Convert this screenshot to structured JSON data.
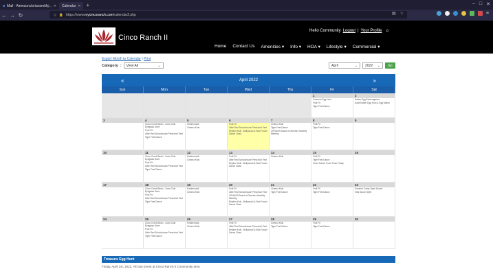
{
  "browser": {
    "tabs": [
      {
        "label": "Mail - Aiemsoncloriansmithj..."
      },
      {
        "label": "Calendar"
      }
    ],
    "url_prefix": "https://www.",
    "url_domain": "mycincoranch.com",
    "url_path": "/calendar2.php"
  },
  "site": {
    "name": "Cinco Ranch II",
    "greeting": "Hello Community",
    "logout": "Logout",
    "separator": "|",
    "profile": "Your Profile",
    "menu": [
      "Home",
      "Contact Us",
      "Amenities ▾",
      "Info ▾",
      "HOA ▾",
      "Lifestyle ▾",
      "Commercial ▾"
    ]
  },
  "links": {
    "export": "Export Month to Calendar",
    "sep": " | ",
    "print": "Print"
  },
  "filter": {
    "label": "Category",
    "value": "View All",
    "month": "April",
    "year": "2022",
    "go": "Go"
  },
  "calendar": {
    "title": "April 2022",
    "prev": "«",
    "next": "»",
    "dows": [
      "Sun",
      "Mon",
      "Tue",
      "Wed",
      "Thu",
      "Fri",
      "Sat"
    ],
    "weeks": [
      [
        {
          "n": "",
          "e": []
        },
        {
          "n": "",
          "e": []
        },
        {
          "n": "",
          "e": []
        },
        {
          "n": "",
          "e": []
        },
        {
          "n": "",
          "e": []
        },
        {
          "n": "1",
          "e": [
            "Treasure Egg Hunt",
            "Fruit Fit",
            "Tiger Feet Dance"
          ]
        },
        {
          "n": "2",
          "e": [
            "Easter Egg Extravaganza",
            "Adult Easter Egg Hunt & Egg Mania"
          ]
        }
      ],
      [
        {
          "n": "3",
          "e": []
        },
        {
          "n": "4",
          "e": [
            "Cinco Creek Basin - Lions Club Eyeglass Drive",
            "Fruit Fit",
            "Little Red Schoolhouse Preschool Fest",
            "Tiger Feet Dance"
          ]
        },
        {
          "n": "5",
          "e": [
            "Kindermusik",
            "Cinema Kids"
          ]
        },
        {
          "n": "6",
          "e": [
            "Fruit Fit",
            "Little Red Schoolhouse Preschool Fest",
            "Rhythm Kids - Bollywood & Kids Fusion Dance Class"
          ],
          "hl": true
        },
        {
          "n": "7",
          "e": [
            "Cinema Kids",
            "Tiger Feet Dance",
            "CRHAOS Board of Directors Monthly Meeting"
          ]
        },
        {
          "n": "8",
          "e": [
            "Fruit Fit",
            "Tiger Feet Dance"
          ]
        },
        {
          "n": "9",
          "e": []
        }
      ],
      [
        {
          "n": "10",
          "e": []
        },
        {
          "n": "11",
          "e": [
            "Cinco Creek Basin - Lions Club Eyeglass Drive",
            "Fruit Fit",
            "Little Red Schoolhouse Preschool Fest",
            "Tiger Feet Dance"
          ]
        },
        {
          "n": "12",
          "e": [
            "Kindermusik",
            "Cinema Kids"
          ]
        },
        {
          "n": "13",
          "e": [
            "Fruit Fit",
            "Little Red Schoolhouse Preschool Fest",
            "Rhythm Kids - Bollywood & Kids Fusion Dance Class"
          ]
        },
        {
          "n": "14",
          "e": [
            "Cinema Kids"
          ]
        },
        {
          "n": "15",
          "e": [
            "Fruit Fit",
            "Tiger Feet Dance",
            "Cinco Ranch Food Truck Friday"
          ]
        },
        {
          "n": "16",
          "e": []
        }
      ],
      [
        {
          "n": "17",
          "e": []
        },
        {
          "n": "18",
          "e": [
            "Cinco Creek Basin - Lions Club Eyeglass Drive",
            "Fruit Fit",
            "Little Red Schoolhouse Preschool Fest",
            "Tiger Feet Dance"
          ]
        },
        {
          "n": "19",
          "e": [
            "Kindermusik",
            "Cinema Kids"
          ]
        },
        {
          "n": "20",
          "e": [
            "Fruit Fit",
            "Little Red Schoolhouse Preschool Fest",
            "CRHAOS Board of Directors Monthly Meeting",
            "Rhythm Kids - Bollywood & Kids Fusion Dance Class"
          ]
        },
        {
          "n": "21",
          "e": [
            "Cinema Kids",
            "Tiger Feet Dance"
          ]
        },
        {
          "n": "22",
          "e": [
            "Fruit Fit",
            "Tiger Feet Dance"
          ]
        },
        {
          "n": "23",
          "e": [
            "Summer Camp Open House",
            "Kids Spa in Style"
          ]
        }
      ],
      [
        {
          "n": "24",
          "e": []
        },
        {
          "n": "25",
          "e": [
            "Cinco Creek Basin - Lions Club Eyeglass Drive",
            "Fruit Fit",
            "Little Red Schoolhouse Preschool Fest",
            "Tiger Feet Dance"
          ]
        },
        {
          "n": "26",
          "e": [
            "Kindermusik",
            "Cinema Kids"
          ]
        },
        {
          "n": "27",
          "e": [
            "Fruit Fit",
            "Little Red Schoolhouse Preschool Fest",
            "Rhythm Kids - Bollywood & Kids Fusion Dance Class"
          ]
        },
        {
          "n": "28",
          "e": [
            "Cinema Kids",
            "Tiger Feet Dance"
          ]
        },
        {
          "n": "29",
          "e": [
            "Fruit Fit",
            "Tiger Feet Dance"
          ]
        },
        {
          "n": "30",
          "e": []
        }
      ]
    ]
  },
  "event": {
    "title": "Treasure Egg Hunt",
    "info": "Friday, April 1st, 2022, All Day Event at Cinco Ranch II Community area"
  },
  "colors": {
    "accent": "#1769b8",
    "header": "#000000",
    "highlight": "#ffffa8",
    "go": "#4aa34a"
  }
}
